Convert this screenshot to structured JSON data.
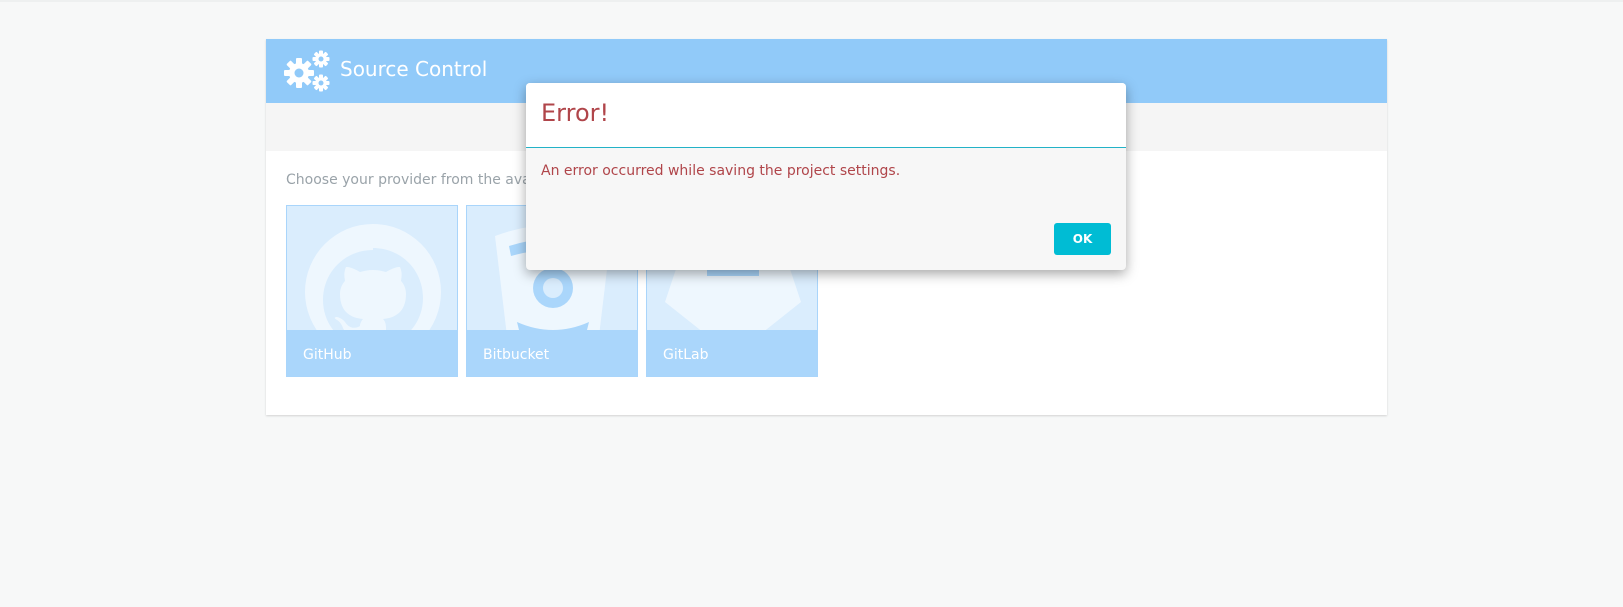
{
  "panel": {
    "title": "Source Control",
    "header_icon": "gears-icon",
    "choose_text": "Choose your provider from the available",
    "providers": [
      {
        "label": "GitHub",
        "icon": "github-icon"
      },
      {
        "label": "Bitbucket",
        "icon": "bitbucket-icon"
      },
      {
        "label": "GitLab",
        "icon": "gitlab-icon"
      }
    ]
  },
  "modal": {
    "title": "Error!",
    "message": "An error occurred while saving the project settings.",
    "ok_label": "OK"
  },
  "colors": {
    "header_bg": "#91caf9",
    "card_bg": "#daedfd",
    "error_text": "#b0454a",
    "ok_button": "#00bcd4"
  }
}
